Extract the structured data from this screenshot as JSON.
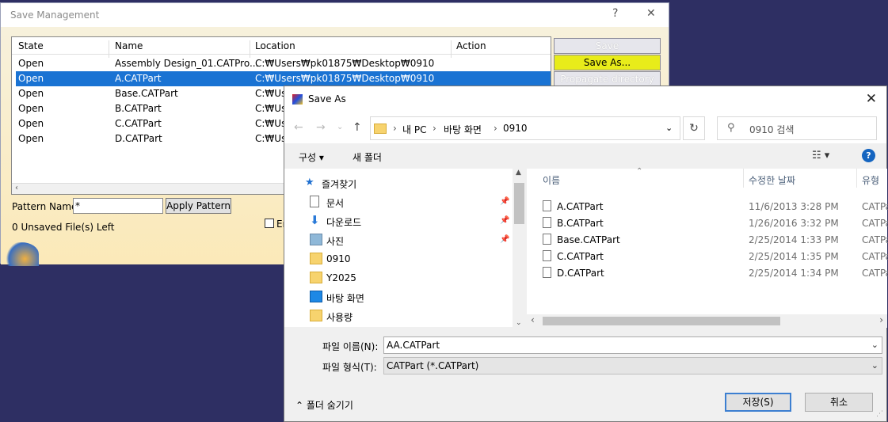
{
  "save_management": {
    "title": "Save Management",
    "help": "?",
    "close": "✕",
    "columns": [
      "State",
      "Name",
      "Location",
      "Action"
    ],
    "rows": [
      {
        "state": "Open",
        "name": "Assembly Design_01.CATPro...",
        "location": "C:₩Users₩pk01875₩Desktop₩0910",
        "selected": false
      },
      {
        "state": "Open",
        "name": "A.CATPart",
        "location": "C:₩Users₩pk01875₩Desktop₩0910",
        "selected": true
      },
      {
        "state": "Open",
        "name": "Base.CATPart",
        "location": "C:₩Use",
        "selected": false
      },
      {
        "state": "Open",
        "name": "B.CATPart",
        "location": "C:₩Use",
        "selected": false
      },
      {
        "state": "Open",
        "name": "C.CATPart",
        "location": "C:₩Use",
        "selected": false
      },
      {
        "state": "Open",
        "name": "D.CATPart",
        "location": "C:₩Use",
        "selected": false
      }
    ],
    "buttons": {
      "save": "Save",
      "save_as": "Save As...",
      "propagate": "Propagate directory"
    },
    "pattern_label": "Pattern Name:",
    "pattern_value": "*",
    "apply_pattern": "Apply Pattern",
    "unsaved": "0 Unsaved File(s) Left",
    "partial_label": "Er"
  },
  "save_as": {
    "title": "Save As",
    "close": "✕",
    "breadcrumb": [
      "내 PC",
      "바탕 화면",
      "0910"
    ],
    "breadcrumb_sep": "›",
    "search_placeholder": "0910 검색",
    "organize": "구성 ▾",
    "new_folder": "새 폴더",
    "nav": [
      {
        "label": "즐겨찾기",
        "icon": "star-icon",
        "pinned": false
      },
      {
        "label": "문서",
        "icon": "document-icon",
        "pinned": true
      },
      {
        "label": "다운로드",
        "icon": "download-icon",
        "pinned": true
      },
      {
        "label": "사진",
        "icon": "picture-icon",
        "pinned": true
      },
      {
        "label": "0910",
        "icon": "folder-icon",
        "pinned": false
      },
      {
        "label": "Y2025",
        "icon": "folder-icon",
        "pinned": false
      },
      {
        "label": "바탕 화면",
        "icon": "desktop-icon",
        "pinned": false
      },
      {
        "label": "사용량",
        "icon": "folder-icon",
        "pinned": false
      }
    ],
    "columns": {
      "name": "이름",
      "date": "수정한 날짜",
      "type": "유형"
    },
    "files": [
      {
        "name": "A.CATPart",
        "date": "11/6/2013 3:28 PM",
        "type": "CATPa"
      },
      {
        "name": "B.CATPart",
        "date": "1/26/2016 3:32 PM",
        "type": "CATPa"
      },
      {
        "name": "Base.CATPart",
        "date": "2/25/2014 1:33 PM",
        "type": "CATPa"
      },
      {
        "name": "C.CATPart",
        "date": "2/25/2014 1:35 PM",
        "type": "CATPa"
      },
      {
        "name": "D.CATPart",
        "date": "2/25/2014 1:34 PM",
        "type": "CATPa"
      }
    ],
    "filename_label": "파일 이름(N):",
    "filename_value": "AA.CATPart",
    "filetype_label": "파일 형식(T):",
    "filetype_value": "CATPart (*.CATPart)",
    "hide_folders": "⌃ 폴더 숨기기",
    "save_button": "저장(S)",
    "cancel_button": "취소"
  },
  "colors": {
    "selection": "#1a73d3",
    "highlight_button": "#e8ec1a",
    "desktop": "#2e2f63"
  }
}
